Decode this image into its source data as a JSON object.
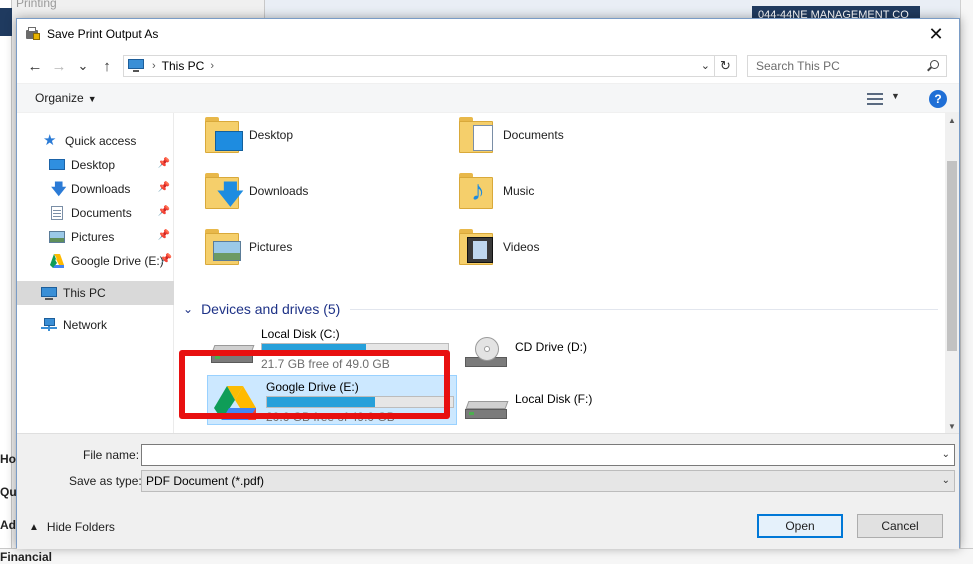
{
  "background": {
    "printing_label": "Printing",
    "company_label": "044-44NE MANAGEMENT CO",
    "side_labels": [
      "Ho",
      "Qu",
      "Ad"
    ],
    "financial_label": "Financial"
  },
  "dialog": {
    "title": "Save Print Output As",
    "close_glyph": "✕"
  },
  "navbar": {
    "back_glyph": "←",
    "forward_glyph": "→",
    "up_glyph": "↑",
    "address_path": "This PC",
    "refresh_glyph": "↻",
    "search_placeholder": "Search This PC"
  },
  "toolbar": {
    "organize_label": "Organize",
    "help_glyph": "?"
  },
  "sidebar": {
    "items": [
      {
        "label": "Quick access",
        "icon": "star-icon"
      },
      {
        "label": "Desktop",
        "icon": "desktop-icon",
        "pinned": true
      },
      {
        "label": "Downloads",
        "icon": "downloads-icon",
        "pinned": true
      },
      {
        "label": "Documents",
        "icon": "documents-icon",
        "pinned": true
      },
      {
        "label": "Pictures",
        "icon": "pictures-icon",
        "pinned": true
      },
      {
        "label": "Google Drive (E:)",
        "icon": "google-drive-icon",
        "pinned": true
      },
      {
        "label": "This PC",
        "icon": "pc-icon",
        "selected": true
      },
      {
        "label": "Network",
        "icon": "network-icon"
      }
    ]
  },
  "folders": [
    {
      "label": "Desktop"
    },
    {
      "label": "Documents"
    },
    {
      "label": "Downloads"
    },
    {
      "label": "Music"
    },
    {
      "label": "Pictures"
    },
    {
      "label": "Videos"
    }
  ],
  "devices_section": {
    "label": "Devices and drives (5)"
  },
  "drives": [
    {
      "name": "Local Disk (C:)",
      "free": "21.7 GB free of 49.0 GB",
      "used_fraction": 0.557
    },
    {
      "name": "CD Drive (D:)"
    },
    {
      "name": "Google Drive (E:)",
      "free": "20.6 GB free of 49.0 GB",
      "used_fraction": 0.58,
      "selected": true
    },
    {
      "name": "Local Disk (F:)"
    }
  ],
  "form": {
    "filename_label": "File name:",
    "filename_value": "",
    "type_label": "Save as type:",
    "type_value": "PDF Document (*.pdf)",
    "hide_folders_label": "Hide Folders",
    "open_label": "Open",
    "cancel_label": "Cancel"
  },
  "colors": {
    "accent": "#0078d7",
    "highlight_border": "#e81010",
    "drive_bar_fill": "#26a0da",
    "section_header": "#1e3287"
  }
}
